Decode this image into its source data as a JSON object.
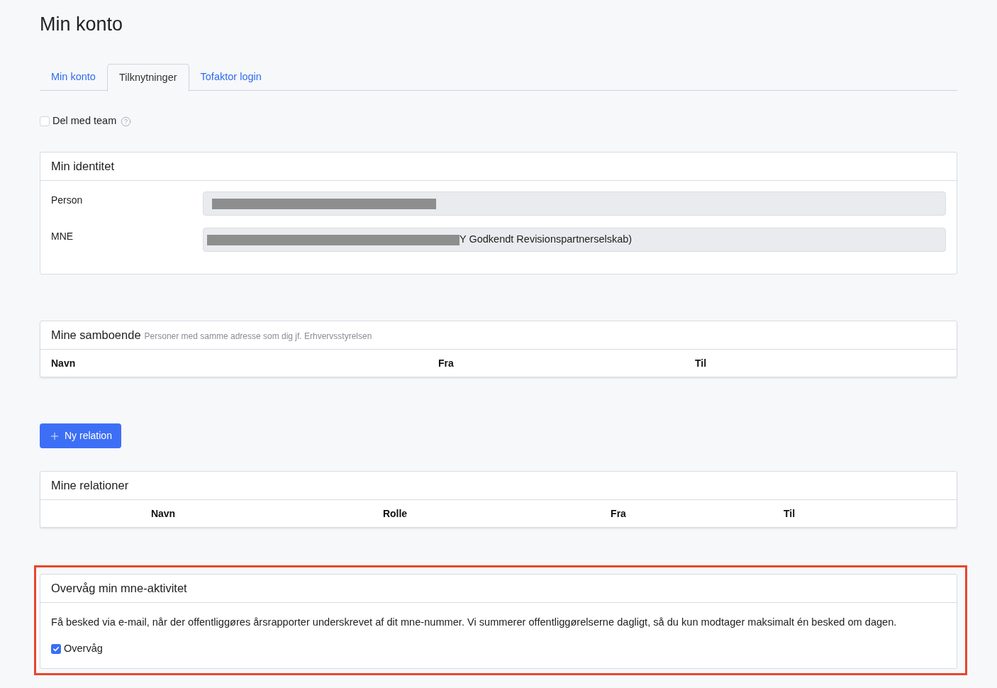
{
  "page": {
    "title": "Min konto"
  },
  "tabs": [
    {
      "label": "Min konto",
      "selected": false
    },
    {
      "label": "Tilknytninger",
      "selected": true
    },
    {
      "label": "Tofaktor login",
      "selected": false
    }
  ],
  "share_option": {
    "label": "Del med team",
    "checked": false
  },
  "identity_card": {
    "title": "Min identitet",
    "fields": [
      {
        "label": "Person",
        "redacted": true
      },
      {
        "label": "MNE",
        "value": "Y Godkendt Revisionspartnerselskab)",
        "redacted": true
      }
    ]
  },
  "cohabitants": {
    "title": "Mine samboende",
    "subtitle": "Personer med samme adresse som dig jf. Erhvervsstyrelsen",
    "columns": [
      "Navn",
      "Fra",
      "Til"
    ]
  },
  "new_relation_button": {
    "label": "Ny relation"
  },
  "relations": {
    "title": "Mine relationer",
    "columns": [
      "Navn",
      "Rolle",
      "Fra",
      "Til"
    ]
  },
  "monitoring": {
    "title": "Overvåg min mne-aktivitet",
    "description": "Få besked via e-mail, når der offentliggøres årsrapporter underskrevet af dit mne-nummer. Vi summerer offentliggørelserne dagligt, så du kun modtager maksimalt én besked om dagen.",
    "option": {
      "label": "Overvåg",
      "checked": true
    },
    "highlighted": true
  }
}
